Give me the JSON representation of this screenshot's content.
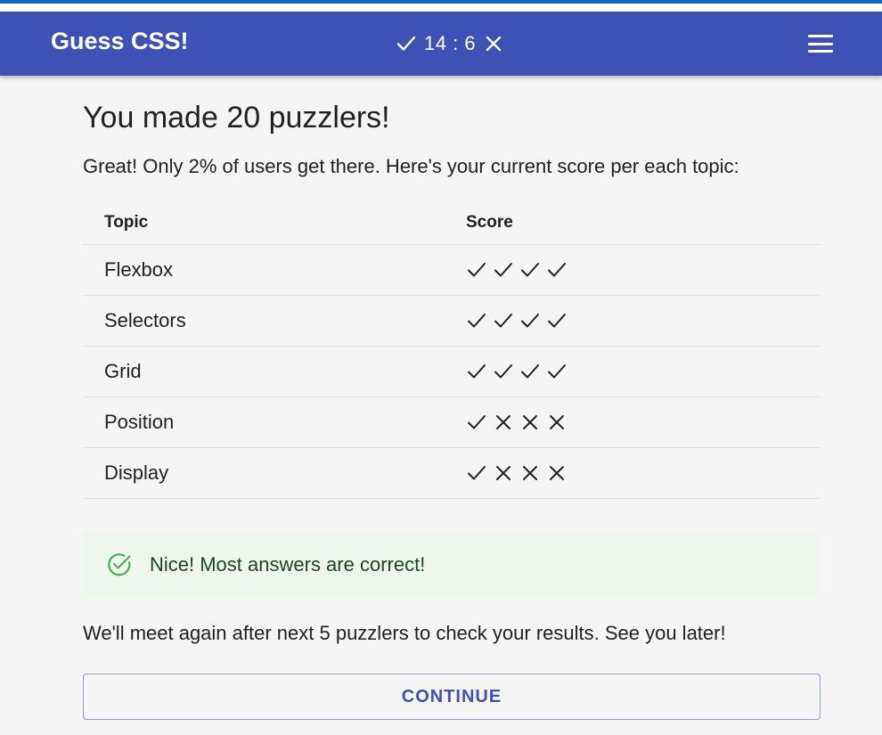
{
  "header": {
    "title": "Guess CSS!",
    "counter": {
      "correct": "14",
      "separator": ":",
      "wrong": "6"
    },
    "menu_icon": "hamburger-menu-icon",
    "colors": {
      "appbar": "#3f51b5",
      "top_line": "#1565c0"
    }
  },
  "main": {
    "heading": "You made 20 puzzlers!",
    "subtitle": "Great! Only 2% of users get there. Here's your current score per each topic:",
    "table": {
      "columns": [
        "Topic",
        "Score"
      ],
      "rows": [
        {
          "topic": "Flexbox",
          "score": [
            "check",
            "check",
            "check",
            "check"
          ]
        },
        {
          "topic": "Selectors",
          "score": [
            "check",
            "check",
            "check",
            "check"
          ]
        },
        {
          "topic": "Grid",
          "score": [
            "check",
            "check",
            "check",
            "check"
          ]
        },
        {
          "topic": "Position",
          "score": [
            "check",
            "cross",
            "cross",
            "cross"
          ]
        },
        {
          "topic": "Display",
          "score": [
            "check",
            "cross",
            "cross",
            "cross"
          ]
        }
      ]
    },
    "alert": {
      "icon": "check-circle-icon",
      "message": "Nice! Most answers are correct!",
      "colors": {
        "background": "#edf7ed",
        "icon": "#4caf50",
        "text": "#1e4620"
      }
    },
    "outro": "We'll meet again after next 5 puzzlers to check your results. See you later!",
    "continue_label": "CONTINUE"
  }
}
